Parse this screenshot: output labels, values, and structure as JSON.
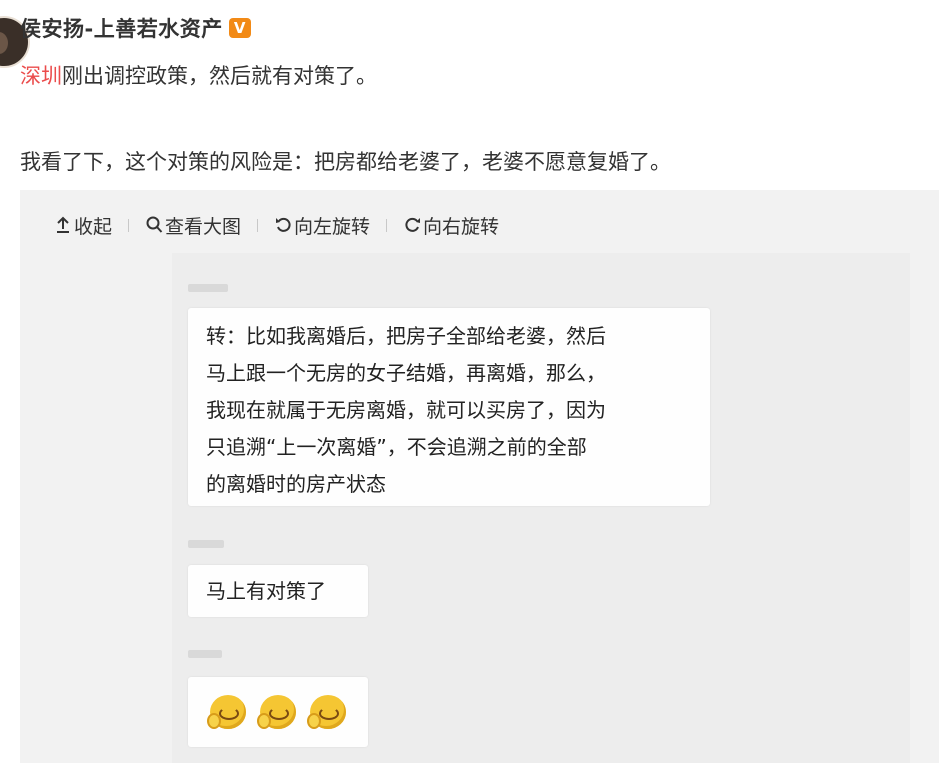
{
  "post": {
    "username": "侯安扬-上善若水资产",
    "verified_badge": "V",
    "line1_topic": "深圳",
    "line1_rest": "刚出调控政策，然后就有对策了。",
    "line2": "我看了下，这个对策的风险是：把房都给老婆了，老婆不愿意复婚了。"
  },
  "toolbar": {
    "collapse": "收起",
    "view_large": "查看大图",
    "rotate_left": "向左旋转",
    "rotate_right": "向右旋转"
  },
  "chat": {
    "message1": [
      "转：比如我离婚后，把房子全部给老婆，然后",
      "马上跟一个无房的女子结婚，再离婚，那么，",
      "我现在就属于无房离婚，就可以买房了，因为",
      "只追溯“上一次离婚”，不会追溯之前的全部",
      "的离婚时的房产状态"
    ],
    "message2": "马上有对策了",
    "message3_emoji": "grimace-emoji"
  },
  "colors": {
    "topic": "#eb4c4c",
    "badge": "#f28a16",
    "media_bg": "#f2f2f2"
  }
}
